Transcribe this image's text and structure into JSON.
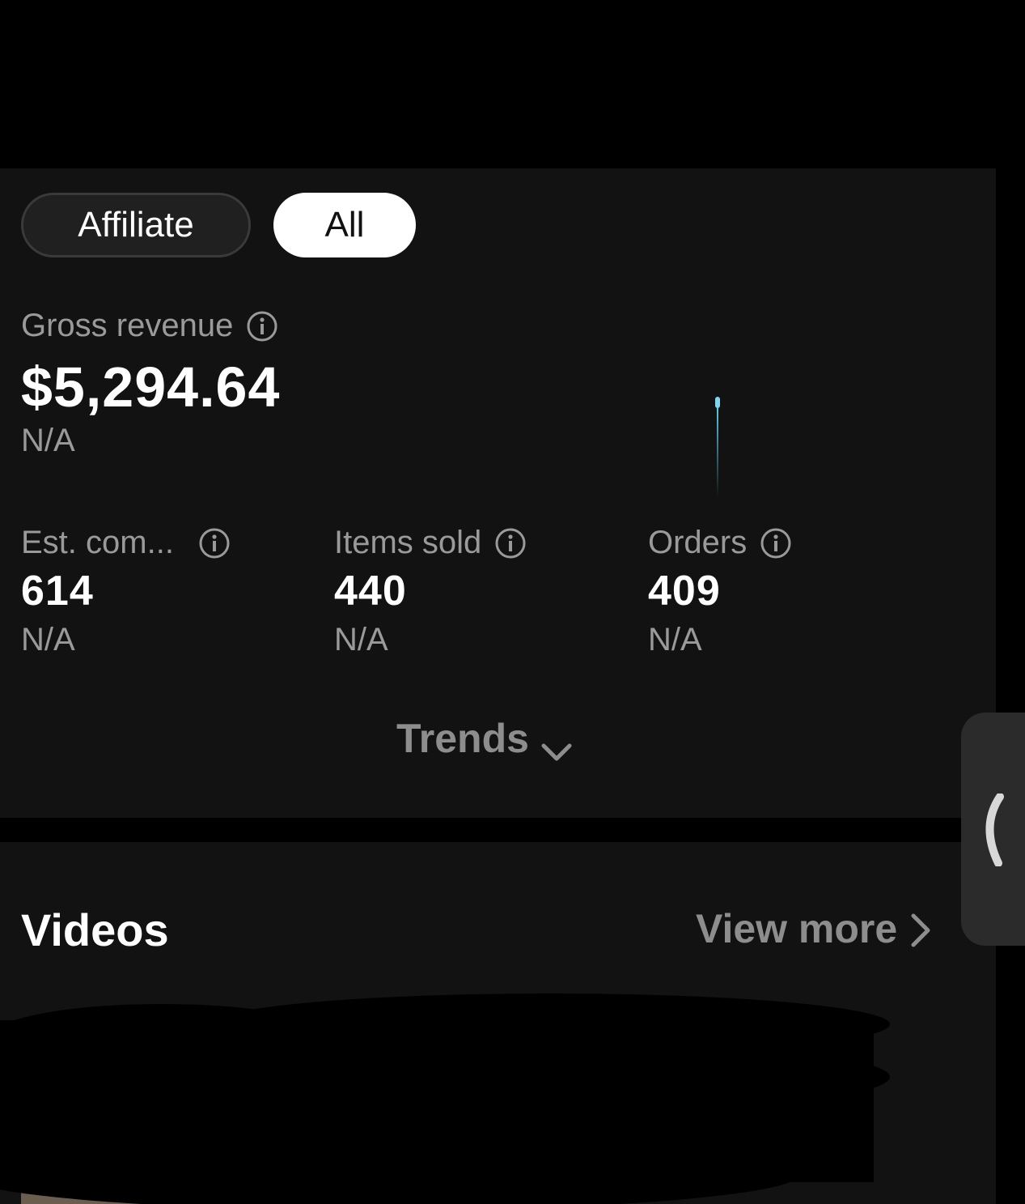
{
  "filters": {
    "affiliate_label": "Affiliate",
    "all_label": "All",
    "selected": "All"
  },
  "gross_revenue": {
    "label": "Gross revenue",
    "value": "$5,294.64",
    "change": "N/A"
  },
  "metrics": [
    {
      "label": "Est. com...",
      "value": "614",
      "change": "N/A"
    },
    {
      "label": "Items sold",
      "value": "440",
      "change": "N/A"
    },
    {
      "label": "Orders",
      "value": "409",
      "change": "N/A"
    }
  ],
  "trends_label": "Trends",
  "videos": {
    "title": "Videos",
    "view_more_label": "View more"
  },
  "colors": {
    "background": "#000000",
    "card": "#121212",
    "muted_text": "#9a9a9a",
    "accent_spark": "#5ec8e5"
  },
  "icons": {
    "info": "info-circle-icon",
    "trends_chevron": "chevron-down-icon",
    "view_more_arrow": "chevron-right-icon",
    "side_handle": "chevron-left-icon"
  }
}
